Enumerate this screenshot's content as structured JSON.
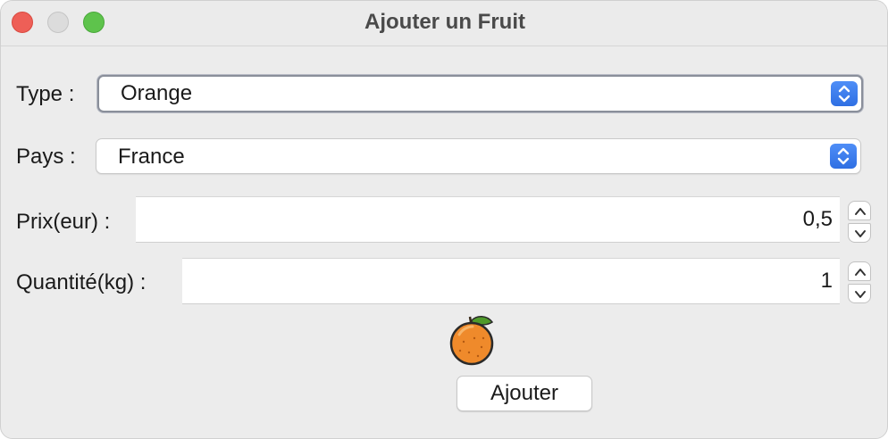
{
  "window": {
    "title": "Ajouter un Fruit"
  },
  "form": {
    "type_label": "Type :",
    "type_value": "Orange",
    "country_label": "Pays :",
    "country_value": "France",
    "price_label": "Prix(eur) :",
    "price_value": "0,5",
    "quantity_label": "Quantité(kg) :",
    "quantity_value": "1"
  },
  "fruit_icon": {
    "name": "orange-icon",
    "color": "#ef8a2b",
    "leaf_color": "#4f9a2a"
  },
  "actions": {
    "add_label": "Ajouter"
  },
  "colors": {
    "accent": "#2f6fe3",
    "close": "#ee5f57",
    "minimize": "#dcdcdc",
    "maximize": "#5ec34c"
  }
}
